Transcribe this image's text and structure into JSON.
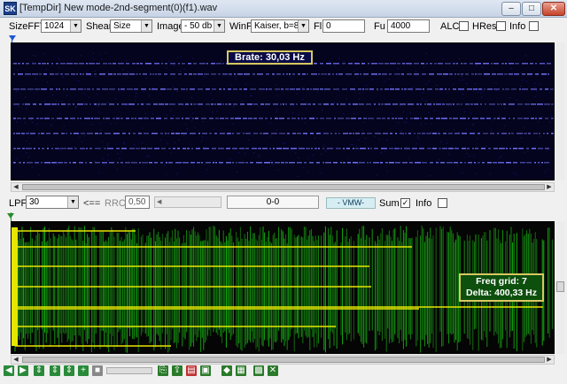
{
  "window": {
    "title": "[TempDir] New mode-2nd-segment(0)(f1).wav",
    "icon_text": "SK",
    "min": "–",
    "max": "□",
    "close": "✕"
  },
  "toolbar": {
    "sizefft_label": "SizeFFT",
    "sizefft_value": "1024",
    "shear_label": "Shear",
    "shear_value": "Size",
    "image_label": "Image",
    "image_value": "- 50 db",
    "winf_label": "WinF",
    "winf_value": "Kaiser, b=8",
    "fl_label": "Fl",
    "fl_value": "0",
    "fu_label": "Fu",
    "fu_value": "4000",
    "alc_label": "ALC",
    "hres_label": "HRes",
    "info_label": "Info"
  },
  "spectrum": {
    "brate": "Brate: 30,03 Hz"
  },
  "middle": {
    "lpf_label": "LPF",
    "lpf_value": "30",
    "arrow_label": "<==",
    "rrc_label": "RRC",
    "rrc_value": "0,50",
    "range_value": "0-0",
    "vmw_label": "- VMW-",
    "sum_label": "Sum",
    "info_label": "Info",
    "sum_checked": "✓"
  },
  "waveform": {
    "freq_grid": "Freq grid: 7",
    "delta": "Delta: 400,33 Hz"
  },
  "colors": {
    "spectrum_bg": "#04041f",
    "spectrum_line": "#3a3aff",
    "wave_green": "#2a9c1a",
    "wave_yellow": "#e6e600",
    "wave_bg": "#050505"
  },
  "bottom_toolbar": {
    "icons": [
      "step-back-icon",
      "step-forward-icon",
      "zoom-in-vertical-icon",
      "zoom-out-vertical-icon",
      "fit-vertical-icon",
      "zoom-plus-icon",
      "stop-icon",
      "copy-icon",
      "export-icon",
      "clipboard-icon",
      "copy-image-icon",
      "diamond-icon",
      "image-icon",
      "grid-icon",
      "cross-icon"
    ]
  }
}
